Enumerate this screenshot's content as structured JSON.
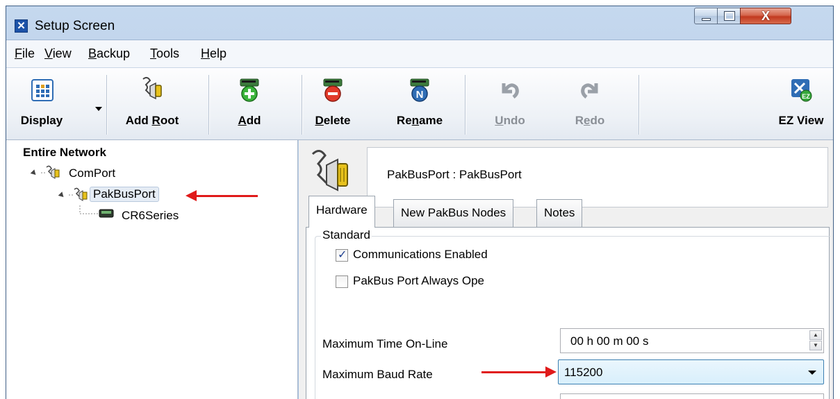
{
  "window": {
    "title": "Setup Screen",
    "title_icon": "setup-icon"
  },
  "menu": {
    "items": [
      {
        "pre": "",
        "ul": "F",
        "post": "ile"
      },
      {
        "pre": "",
        "ul": "V",
        "post": "iew"
      },
      {
        "pre": "",
        "ul": "B",
        "post": "ackup"
      },
      {
        "pre": "",
        "ul": "T",
        "post": "ools"
      },
      {
        "pre": "",
        "ul": "H",
        "post": "elp"
      }
    ]
  },
  "toolbar": {
    "display": "Display",
    "add_root": {
      "pre": "Add ",
      "ul": "R",
      "post": "oot"
    },
    "add": {
      "pre": "",
      "ul": "A",
      "post": "dd"
    },
    "delete": {
      "pre": "",
      "ul": "D",
      "post": "elete"
    },
    "rename": {
      "pre": "Re",
      "ul": "n",
      "post": "ame"
    },
    "undo": {
      "pre": "",
      "ul": "U",
      "post": "ndo"
    },
    "redo": {
      "pre": "R",
      "ul": "e",
      "post": "do"
    },
    "ez_view": "EZ View"
  },
  "tree": {
    "header": "Entire Network",
    "nodes": [
      {
        "label": "ComPort",
        "icon": "serial-port-icon"
      },
      {
        "label": "PakBusPort",
        "icon": "serial-port-icon"
      },
      {
        "label": "CR6Series",
        "icon": "datalogger-icon"
      }
    ]
  },
  "detail": {
    "header": "PakBusPort : PakBusPort",
    "tabs": [
      "Hardware",
      "New PakBus Nodes",
      "Notes"
    ],
    "active_tab": "Hardware",
    "group_title": "Standard",
    "comms_enabled_label": "Communications Enabled",
    "comms_enabled_checked": true,
    "always_open_label": "PakBus Port Always Ope",
    "always_open_checked": false,
    "max_time_label": "Maximum Time On-Line",
    "max_time_value": "00 h 00 m 00 s",
    "max_baud_label": "Maximum Baud Rate",
    "max_baud_value": "115200"
  },
  "colors": {
    "annotation_arrow": "#e01a1a",
    "selection": "#e5ecf5",
    "dropdown_highlight": "#d8effc"
  }
}
